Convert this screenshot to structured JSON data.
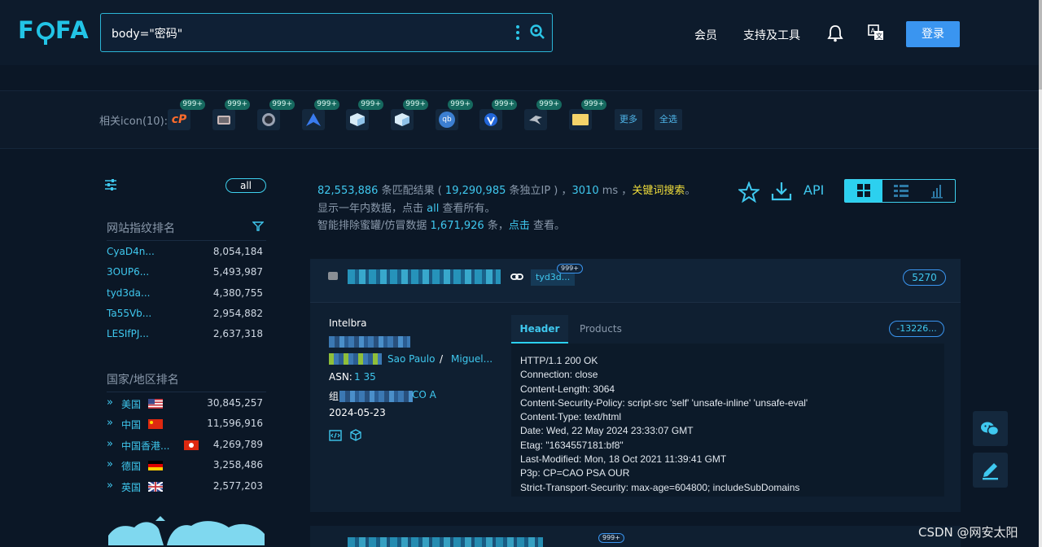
{
  "header": {
    "logo": "FOFA",
    "search_value": "body=\"密码\"",
    "nav": [
      "会员",
      "支持及工具"
    ],
    "login_label": "登录"
  },
  "icon_bar": {
    "label": "相关icon(10):",
    "badge": "999+",
    "icons": [
      "cpanel-icon",
      "camera-icon",
      "lens-icon",
      "arrow-a-icon",
      "cube-icon",
      "cube-icon",
      "qb-icon",
      "shield-icon",
      "bird-icon",
      "envelope-icon"
    ],
    "more_label": "更多",
    "select_all_label": "全选"
  },
  "sidebar": {
    "all_label": "all",
    "fingerprint_title": "网站指纹排名",
    "fingerprints": [
      {
        "name": "CyaD4n...",
        "count": "8,054,184"
      },
      {
        "name": "3OUP6...",
        "count": "5,493,987"
      },
      {
        "name": "tyd3da...",
        "count": "4,380,755"
      },
      {
        "name": "Ta55Vb...",
        "count": "2,954,882"
      },
      {
        "name": "LESIfPJ...",
        "count": "2,637,318"
      }
    ],
    "country_title": "国家/地区排名",
    "countries": [
      {
        "name": "美国",
        "count": "30,845,257",
        "flag": "us"
      },
      {
        "name": "中国",
        "count": "11,596,916",
        "flag": "cn"
      },
      {
        "name": "中国香港...",
        "count": "4,269,789",
        "flag": "hk"
      },
      {
        "name": "德国",
        "count": "3,258,486",
        "flag": "de"
      },
      {
        "name": "英国",
        "count": "2,577,203",
        "flag": "gb"
      }
    ]
  },
  "summary": {
    "matches": "82,553,886",
    "matches_suffix": " 条匹配结果 ( ",
    "unique_ip": "19,290,985",
    "unique_ip_suffix": " 条独立IP ) ，",
    "ms": "3010",
    "ms_suffix": " ms ，",
    "keyword_search": "关键词搜索",
    "period": "。",
    "line2_prefix": "显示一年内数据，点击 ",
    "line2_all": "all",
    "line2_suffix": " 查看所有。",
    "line3_prefix": "智能排除蜜罐/仿冒数据 ",
    "line3_count": "1,671,926",
    "line3_mid": " 条，",
    "line3_click": "点击",
    "line3_suffix": " 查看。",
    "api_label": "API"
  },
  "result": {
    "tag": "tyd3d...",
    "tag_badge": "999+",
    "port": "5270",
    "org": "Intelbra",
    "city": "Sao Paulo",
    "slash": "/",
    "region": "Miguel...",
    "asn_label": "ASN:",
    "asn_value": "1  35",
    "isp_label": "组",
    "isp_value": "CO   A",
    "date": "2024-05-23",
    "tab_header": "Header",
    "tab_products": "Products",
    "hash": "-13226...",
    "header_lines": [
      "HTTP/1.1 200 OK",
      "Connection: close",
      "Content-Length: 3064",
      "Content-Security-Policy: script-src 'self' 'unsafe-inline' 'unsafe-eval'",
      "Content-Type: text/html",
      "Date: Wed, 22 May 2024 23:33:07 GMT",
      "Etag: \"1634557181:bf8\"",
      "Last-Modified: Mon, 18 Oct 2021 11:39:41 GMT",
      "P3p: CP=CAO PSA OUR",
      "Strict-Transport-Security: max-age=604800; includeSubDomains"
    ]
  },
  "result2": {
    "badge": "999+"
  },
  "watermark": "CSDN @网安太阳",
  "colors": {
    "background": "#0b1726",
    "accent": "#3fc8ef",
    "keyword": "#f2df3b",
    "login": "#3a95f0"
  }
}
